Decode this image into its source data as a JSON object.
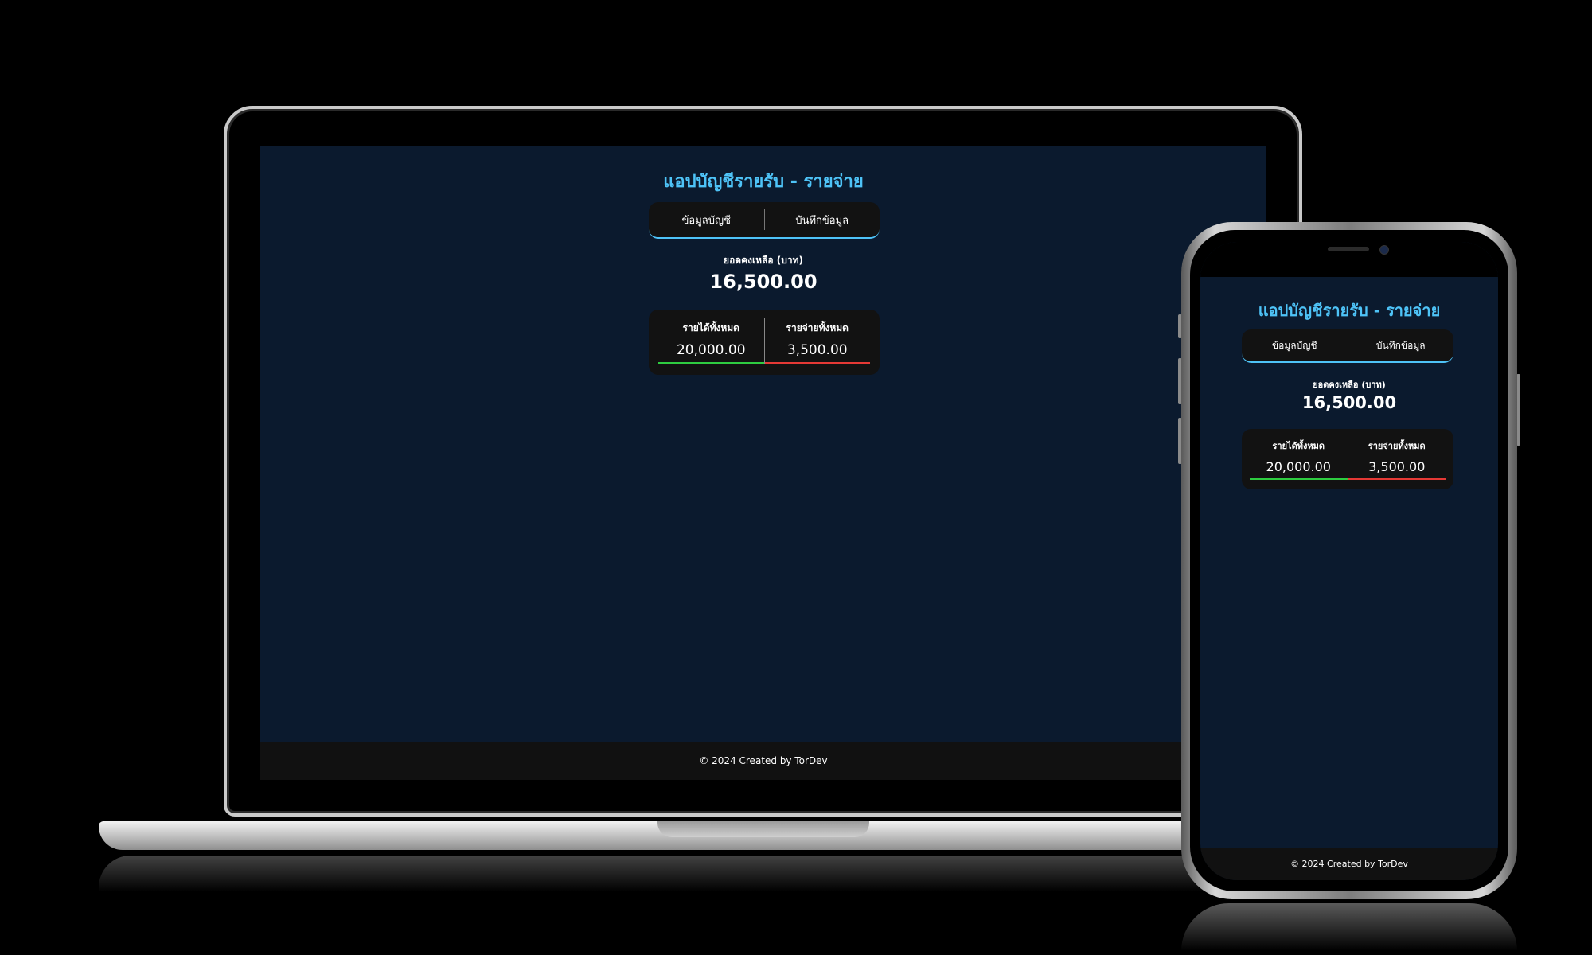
{
  "app": {
    "title": "แอปบัญชีรายรับ - รายจ่าย",
    "tabs": [
      {
        "label": "ข้อมูลบัญชี"
      },
      {
        "label": "บันทึกข้อมูล"
      }
    ],
    "balance": {
      "label": "ยอดคงเหลือ (บาท)",
      "value": "16,500.00"
    },
    "summary": {
      "income_label": "รายได้ทั้งหมด",
      "income_value": "20,000.00",
      "expense_label": "รายจ่ายทั้งหมด",
      "expense_value": "3,500.00"
    },
    "footer": "© 2024 Created by TorDev"
  },
  "colors": {
    "background": "#000000",
    "screen": "#0b1a2e",
    "accent": "#4ec3f7",
    "panel": "#121212",
    "income": "#2ecc40",
    "expense": "#e53935"
  }
}
